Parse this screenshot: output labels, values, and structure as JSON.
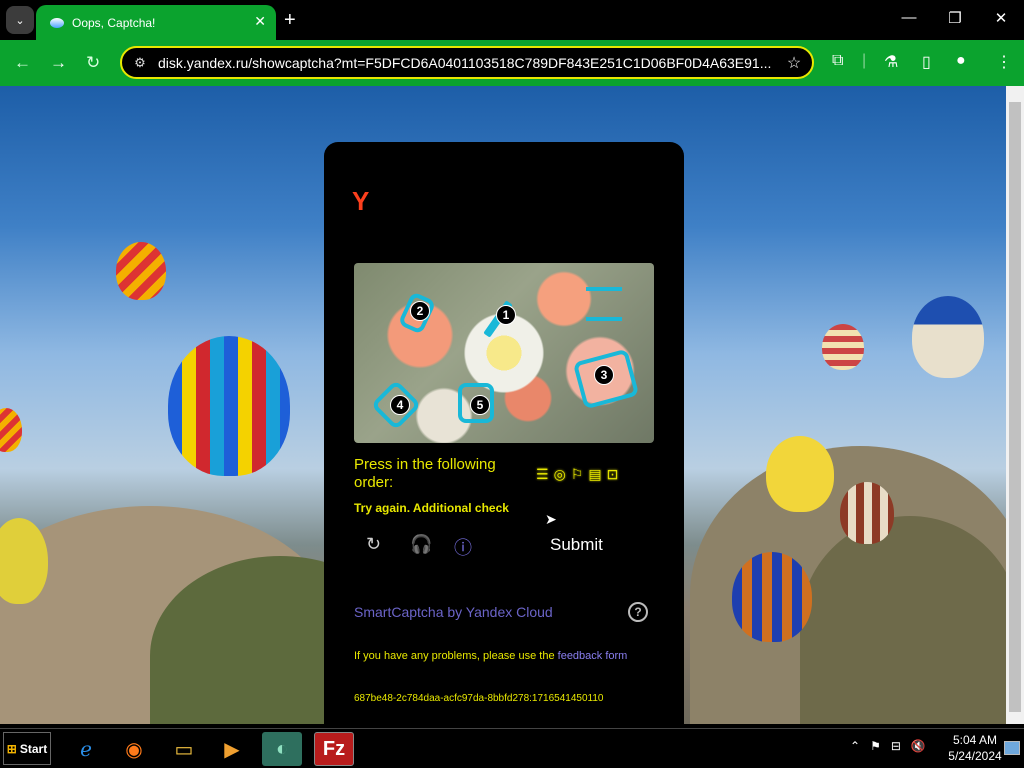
{
  "browser": {
    "tab_title": "Oops, Captcha!",
    "url": "disk.yandex.ru/showcaptcha?mt=F5DFCD6A0401103518C789DF843E251C1D06BF0D4A63E91...",
    "accent_color": "#0ba32e"
  },
  "captcha": {
    "logo": "Y",
    "marks": [
      "1",
      "2",
      "3",
      "4",
      "5"
    ],
    "prompt": "Press in the following order:",
    "error": "Try again. Additional check",
    "submit_label": "Submit",
    "brand": "SmartCaptcha by Yandex Cloud",
    "problems_text": "If you have any problems, please use the",
    "feedback_link": "feedback form",
    "token": "687be48-2c784daa-acfc97da-8bbfd278:1716541450110"
  },
  "taskbar": {
    "start_label": "Start",
    "time": "5:04 AM",
    "date": "5/24/2024"
  }
}
